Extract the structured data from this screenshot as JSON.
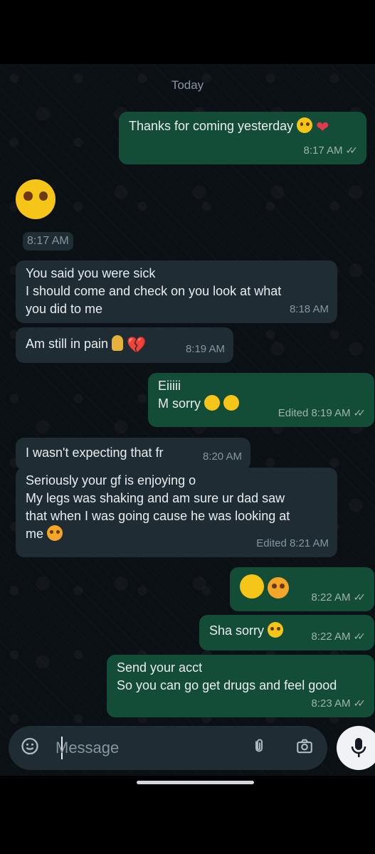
{
  "date_label": "Today",
  "messages": [
    {
      "dir": "out",
      "text": "Thanks for coming yesterday",
      "time": "8:17 AM"
    },
    {
      "dir": "in",
      "text": "",
      "time": "8:17 AM",
      "emoji": "unamused-face"
    },
    {
      "dir": "in",
      "text": "You said you were sick\nI should come and check on you look at what\nyou did to me",
      "time": "8:18 AM"
    },
    {
      "dir": "in",
      "text": "Am still in pain",
      "time": "8:19 AM"
    },
    {
      "dir": "out",
      "text": "Eiiiii\nM sorry",
      "time": "Edited 8:19 AM"
    },
    {
      "dir": "in",
      "text": "I wasn't expecting that fr",
      "time": "8:20 AM"
    },
    {
      "dir": "in",
      "text": "Seriously your gf is enjoying o\nMy legs was shaking and am sure ur dad saw\nthat when I was going cause he was looking at\nme",
      "time": "Edited 8:21 AM"
    },
    {
      "dir": "out",
      "text": "",
      "time": "8:22 AM"
    },
    {
      "dir": "out",
      "text": "Sha sorry",
      "time": "8:22 AM"
    },
    {
      "dir": "out",
      "text": "Send your acct\nSo you can go get drugs and feel good",
      "time": "8:23 AM"
    }
  ],
  "input": {
    "placeholder": "Message"
  },
  "icons": {
    "sticker": "sticker-icon",
    "attach": "paperclip-icon",
    "camera": "camera-icon",
    "mic": "mic-icon"
  },
  "colors": {
    "incoming": "#1f2c33",
    "outgoing": "#144d37",
    "background": "#0b1014"
  }
}
